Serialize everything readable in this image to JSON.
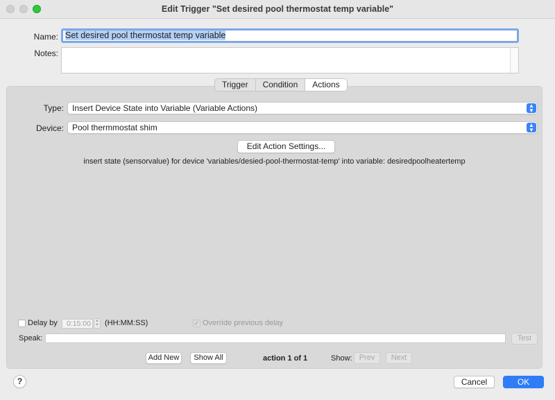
{
  "window": {
    "title": "Edit Trigger \"Set desired pool thermostat temp variable\""
  },
  "form": {
    "name_label": "Name:",
    "name_value": "Set desired pool thermostat temp variable",
    "notes_label": "Notes:",
    "notes_value": ""
  },
  "tabs": [
    {
      "label": "Trigger",
      "active": false
    },
    {
      "label": "Condition",
      "active": false
    },
    {
      "label": "Actions",
      "active": true
    }
  ],
  "actions": {
    "type_label": "Type:",
    "type_value": "Insert Device State into Variable (Variable Actions)",
    "device_label": "Device:",
    "device_value": "Pool thermmostat shim",
    "edit_button": "Edit Action Settings...",
    "description": "insert state (sensorvalue) for device 'variables/desied-pool-thermostat-temp' into variable: desiredpoolheatertemp"
  },
  "delay": {
    "label": "Delay by",
    "checked": false,
    "value": "0:15:00",
    "format": "(HH:MM:SS)",
    "override_label": "Override previous delay",
    "override_checked": true
  },
  "speak": {
    "label": "Speak:",
    "value": "",
    "test_button": "Test"
  },
  "action_nav": {
    "add_new": "Add New",
    "show_all": "Show All",
    "counter": "action 1 of 1",
    "show_label": "Show:",
    "prev": "Prev",
    "next": "Next"
  },
  "footer": {
    "help": "?",
    "cancel": "Cancel",
    "ok": "OK"
  },
  "colors": {
    "accent": "#2f7cf6",
    "selection": "#b4d0f5",
    "focus_ring": "#7da7e8"
  }
}
